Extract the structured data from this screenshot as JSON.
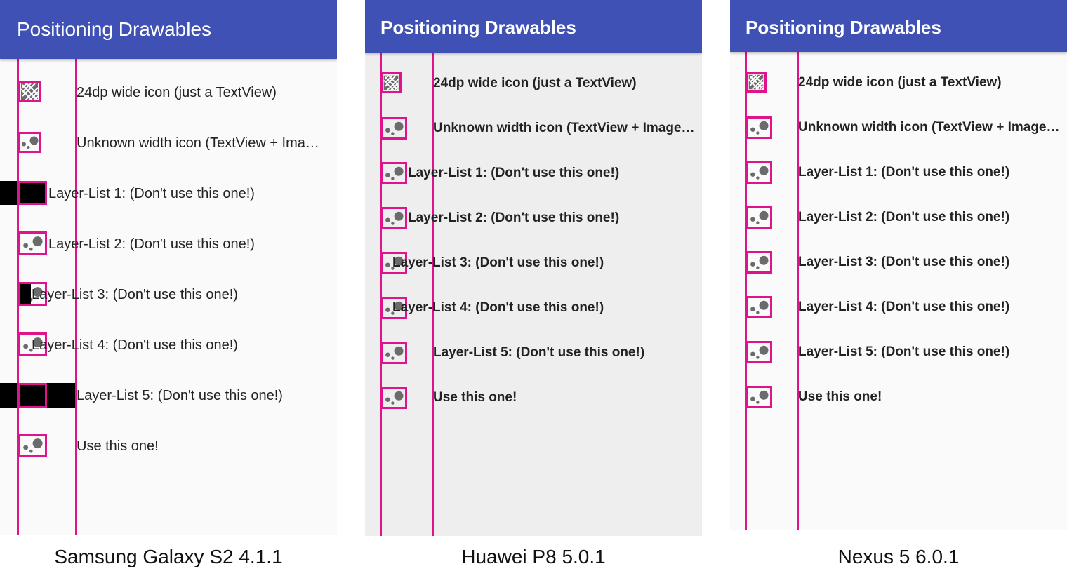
{
  "app": {
    "title": "Positioning Drawables"
  },
  "colors": {
    "appbar": "#3f51b5",
    "guide": "#e0138c",
    "icon_fill": "#6b6b6b",
    "bg_samsung": "#fafafa",
    "bg_huawei": "#eeeeee",
    "bg_nexus": "#fafafa"
  },
  "rows": [
    {
      "label": "24dp wide icon (just a TextView)",
      "icon": "broken-image-icon"
    },
    {
      "label": "Unknown width icon (TextView + ImageView)",
      "icon": "dots-icon"
    },
    {
      "label": "Layer-List 1: (Don't use this one!)",
      "icon": "dots-icon"
    },
    {
      "label": "Layer-List 2: (Don't use this one!)",
      "icon": "dots-icon"
    },
    {
      "label": "Layer-List 3: (Don't use this one!)",
      "icon": "dots-icon"
    },
    {
      "label": "Layer-List 4: (Don't use this one!)",
      "icon": "dots-icon"
    },
    {
      "label": "Layer-List 5: (Don't use this one!)",
      "icon": "dots-icon"
    },
    {
      "label": "Use this one!",
      "icon": "dots-icon"
    }
  ],
  "samsung": {
    "row2_label": "Unknown width icon (TextView + Ima…"
  },
  "captions": {
    "samsung": "Samsung Galaxy S2 4.1.1",
    "huawei": "Huawei P8 5.0.1",
    "nexus": "Nexus 5 6.0.1"
  }
}
